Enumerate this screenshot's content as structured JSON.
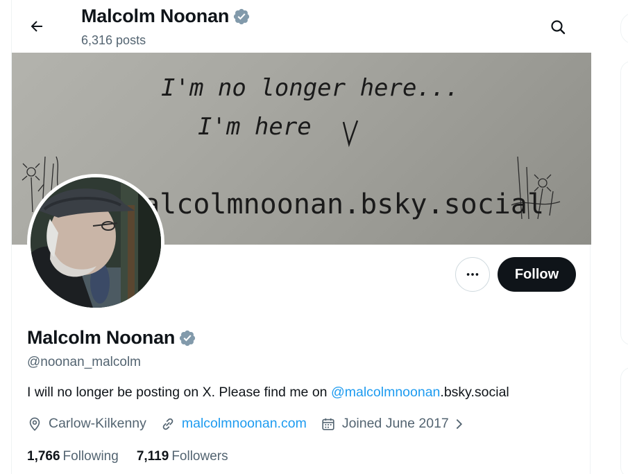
{
  "header": {
    "title": "Malcolm Noonan",
    "posts_count": "6,316 posts"
  },
  "banner": {
    "line1": "I'm no longer here...",
    "line2": "I'm here",
    "line3": "malcolmnoonan.bsky.social"
  },
  "actions": {
    "follow_label": "Follow"
  },
  "profile": {
    "name": "Malcolm Noonan",
    "handle": "@noonan_malcolm",
    "bio_prefix": "I will no longer be posting on X. Please find me on ",
    "bio_mention": "@malcolmnoonan",
    "bio_suffix": ".bsky.social",
    "location": "Carlow-Kilkenny",
    "website": "malcolmnoonan.com",
    "joined": "Joined June 2017",
    "following_count": "1,766",
    "following_label": "Following",
    "followers_count": "7,119",
    "followers_label": "Followers"
  },
  "colors": {
    "accent": "#1d9bf0",
    "text_primary": "#0f1419",
    "text_secondary": "#536471",
    "verified_badge": "#829aab"
  },
  "icons": [
    "back-arrow-icon",
    "search-icon",
    "verified-badge-icon",
    "more-options-icon",
    "location-pin-icon",
    "link-icon",
    "calendar-icon",
    "chevron-right-icon"
  ]
}
